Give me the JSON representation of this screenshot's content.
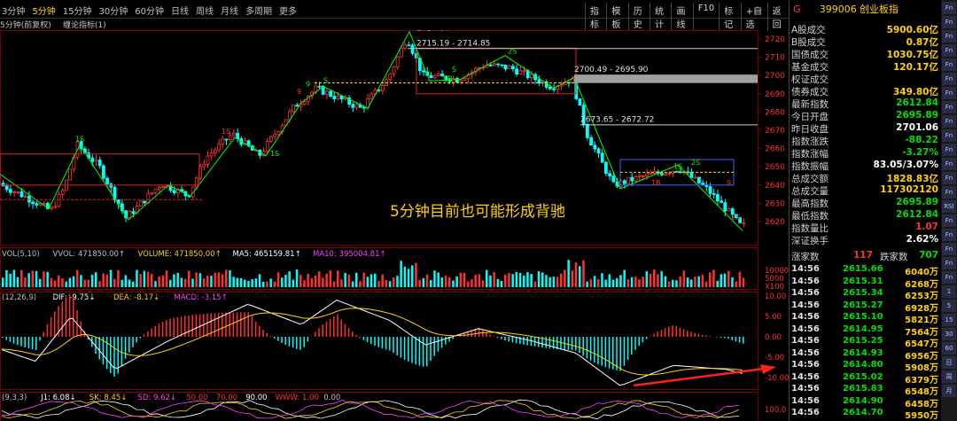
{
  "toolbar": {
    "periods": [
      "3分钟",
      "5分钟",
      "15分钟",
      "30分钟",
      "60分钟",
      "日线",
      "周线",
      "月线",
      "多周期",
      "更多"
    ],
    "active_period": "5分钟",
    "tools": [
      "指标",
      "模板",
      "历史",
      "统计",
      "画线",
      "F10",
      "标记",
      "+自选",
      "返回"
    ],
    "sub": [
      "5分钟(前复权)",
      "缠论指标(1)"
    ]
  },
  "chart_labels": {
    "high_label": "2724.04",
    "range1": "2715.19 - 2714.85",
    "range2": "2700.49 - 2695.90",
    "range3": "2673.65 - 2672.72",
    "annotation": "5分钟目前也可能形成背驰",
    "price_ticks": [
      "2720",
      "2710",
      "2700",
      "2690",
      "2680",
      "2670",
      "2660",
      "2650",
      "2640",
      "2630",
      "2620"
    ],
    "vol_legend": [
      "VOL(5,10)",
      "VVOL: 471850.00↑",
      "VOLUME: 471850.00↑",
      "MA5: 465159.81↑",
      "MA10: 395004.81↑"
    ],
    "vol_ticks": [
      "10000",
      "5000",
      "X100"
    ],
    "macd_legend": [
      "(12,26,9)",
      "DIF: -9.75↓",
      "DEA: -8.17↓",
      "MACD: -3.15↑"
    ],
    "macd_ticks": [
      "10.00",
      "5.00",
      "0.00",
      "-5.00",
      "-10.00"
    ],
    "kdj_legend": [
      "(9,3,3)",
      "J1: 6.08↓",
      "SK: 8.45↓",
      "SD: 9.62↓",
      "50.00",
      "70.00",
      "90.00",
      "WWW: 1.00",
      "0.00"
    ],
    "kdj_ticks": [
      "100.0"
    ],
    "small_marks": [
      "1S",
      "1S",
      "S",
      "2S",
      "1B",
      "1S",
      "1B",
      "9",
      "9",
      "S",
      "9",
      "2S",
      "1S",
      "2S"
    ]
  },
  "colors": {
    "up": "#ff3030",
    "down": "#00ffff",
    "dif": "#ffffff",
    "dea": "#ffd200",
    "accent": "#ffd200",
    "green": "#00e000"
  },
  "panel": {
    "letter": "G",
    "code": "399006",
    "name": "创业板指",
    "rows": [
      {
        "k": "A股成交",
        "v": "5900.60亿",
        "c": "#ffd200"
      },
      {
        "k": "B股成交",
        "v": "0.87亿",
        "c": "#ffd200"
      },
      {
        "k": "国债成交",
        "v": "1030.75亿",
        "c": "#ffd200"
      },
      {
        "k": "基金成交",
        "v": "120.17亿",
        "c": "#ffd200"
      },
      {
        "k": "权证成交",
        "v": "",
        "c": "#ffd200"
      },
      {
        "k": "债券成交",
        "v": "349.80亿",
        "c": "#ffd200"
      },
      {
        "k": "最新指数",
        "v": "2612.84",
        "c": "#00e000"
      },
      {
        "k": "今日开盘",
        "v": "2695.89",
        "c": "#00e000"
      },
      {
        "k": "昨日收盘",
        "v": "2701.06",
        "c": "#ffffff"
      },
      {
        "k": "指数涨跌",
        "v": "-88.22",
        "c": "#00e000"
      },
      {
        "k": "指数涨幅",
        "v": "-3.27%",
        "c": "#00e000"
      },
      {
        "k": "指数振幅",
        "v": "83.05/3.07%",
        "c": "#ffffff"
      },
      {
        "k": "总成交额",
        "v": "1828.83亿",
        "c": "#ffd200"
      },
      {
        "k": "总成交量",
        "v": "117302120",
        "c": "#ffd200"
      },
      {
        "k": "最高指数",
        "v": "2695.89",
        "c": "#00e000"
      },
      {
        "k": "最低指数",
        "v": "2612.84",
        "c": "#00e000"
      },
      {
        "k": "指数量比",
        "v": "1.07",
        "c": "#ff3030"
      },
      {
        "k": "深证换手",
        "v": "2.62%",
        "c": "#ffffff"
      }
    ],
    "updown": {
      "up_label": "涨家数",
      "up": "117",
      "down_label": "跌家数",
      "down": "707"
    },
    "ticks": [
      {
        "t": "14:56",
        "p": "2615.66",
        "q": "6040万"
      },
      {
        "t": "14:56",
        "p": "2615.31",
        "q": "6268万"
      },
      {
        "t": "14:56",
        "p": "2615.34",
        "q": "6253万"
      },
      {
        "t": "14:56",
        "p": "2615.27",
        "q": "6928万"
      },
      {
        "t": "14:56",
        "p": "2615.10",
        "q": "5821万"
      },
      {
        "t": "14:56",
        "p": "2614.95",
        "q": "7564万"
      },
      {
        "t": "14:56",
        "p": "2615.25",
        "q": "6547万"
      },
      {
        "t": "14:56",
        "p": "2614.93",
        "q": "6956万"
      },
      {
        "t": "14:56",
        "p": "2614.80",
        "q": "5908万"
      },
      {
        "t": "14:56",
        "p": "2615.02",
        "q": "6379万"
      },
      {
        "t": "14:56",
        "p": "2615.83",
        "q": "6548万"
      },
      {
        "t": "14:56",
        "p": "2614.90",
        "q": "6458万"
      },
      {
        "t": "14:56",
        "p": "2614.70",
        "q": "5950万"
      }
    ]
  },
  "strip": [
    "Fn",
    "Fn",
    "Fn",
    "Fn",
    "Fn",
    "Fn",
    "Fn",
    "Fn",
    "Fn",
    "Fn",
    "Fn",
    "Fn",
    "Fn",
    "Fn",
    "RSI",
    "Fn",
    "Fn",
    "Fn",
    "Fn",
    "Fn",
    "1",
    "5",
    "15",
    "30",
    "60",
    "日",
    "周",
    "月"
  ]
}
